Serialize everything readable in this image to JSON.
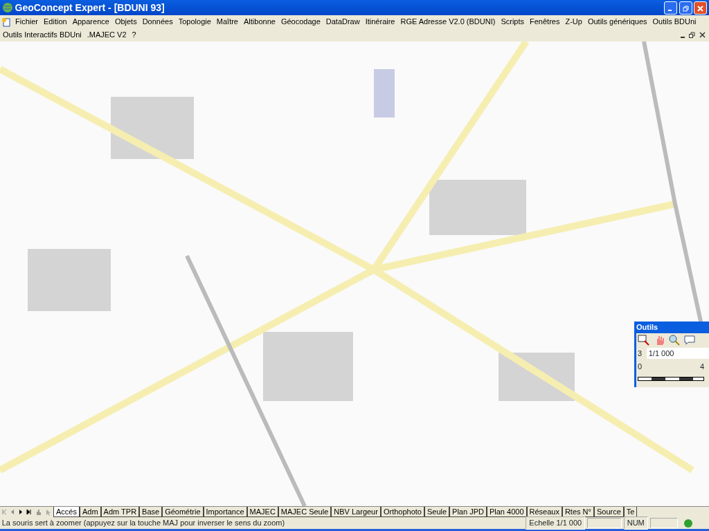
{
  "window": {
    "title": "GeoConcept Expert - [BDUNI 93]"
  },
  "menu": [
    "Fichier",
    "Edition",
    "Apparence",
    "Objets",
    "Données",
    "Topologie",
    "Maître",
    "Altibonne",
    "Géocodage",
    "DataDraw",
    "Itinéraire",
    "RGE Adresse V2.0 (BDUNI)",
    "Scripts",
    "Fenêtres",
    "Z-Up",
    "Outils génériques",
    "Outils BDUni"
  ],
  "menu2": [
    "Outils Interactifs BDUni",
    ".MAJEC V2",
    "?"
  ],
  "tools_window": {
    "title": "Outils",
    "layer": "3",
    "scale": "1/1 000",
    "scale_start": "0",
    "scale_end": "4"
  },
  "tabs": [
    {
      "label": "Accés",
      "selected": true
    },
    {
      "label": "Adm",
      "selected": false
    },
    {
      "label": "Adm TPR",
      "selected": false
    },
    {
      "label": "Base",
      "selected": false
    },
    {
      "label": "Géométrie",
      "selected": false
    },
    {
      "label": "Importance",
      "selected": false
    },
    {
      "label": "MAJEC",
      "selected": false
    },
    {
      "label": "MAJEC Seule",
      "selected": false
    },
    {
      "label": "NBV Largeur",
      "selected": false
    },
    {
      "label": "Orthophoto",
      "selected": false
    },
    {
      "label": "Seule",
      "selected": false
    },
    {
      "label": "Plan JPD",
      "selected": false
    },
    {
      "label": "Plan 4000",
      "selected": false
    },
    {
      "label": "Réseaux",
      "selected": false
    },
    {
      "label": "Rtes N°",
      "selected": false
    },
    {
      "label": "Source",
      "selected": false
    },
    {
      "label": "Te",
      "selected": false
    }
  ],
  "status_bar": {
    "message": "La souris sert à zoomer (appuyez sur la touche MAJ pour inverser le sens du zoom)",
    "scale": "Echelle 1/1 000",
    "num": "NUM"
  }
}
